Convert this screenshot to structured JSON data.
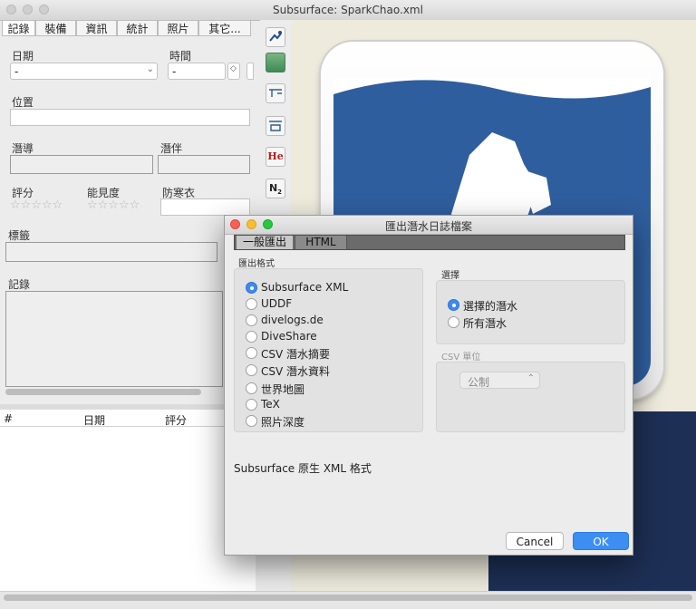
{
  "window": {
    "title": "Subsurface: SparkChao.xml"
  },
  "tabs": [
    "記錄",
    "裝備",
    "資訊",
    "統計",
    "照片",
    "其它..."
  ],
  "form": {
    "date_label": "日期",
    "date_value": "-",
    "time_label": "時間",
    "time_value": "-",
    "location_label": "位置",
    "divemaster_label": "潛導",
    "buddy_label": "潛伴",
    "rating_label": "評分",
    "visibility_label": "能見度",
    "suit_label": "防寒衣",
    "tags_label": "標籤",
    "notes_label": "記錄",
    "rating_stars": "☆☆☆☆☆",
    "visibility_stars": "☆☆☆☆☆"
  },
  "dive_list": {
    "columns": [
      "#",
      "日期",
      "評分"
    ]
  },
  "toolbar": {
    "icons": [
      "diver-icon",
      "calculator-icon",
      "ruler-icon",
      "ceiling-icon",
      "helium-icon",
      "nitrogen-icon"
    ],
    "he_label": "He",
    "n2_label": "N",
    "n2_sub": "2"
  },
  "dialog": {
    "title": "匯出潛水日誌檔案",
    "tabs": [
      "一般匯出",
      "HTML"
    ],
    "format_group_title": "匯出格式",
    "formats": [
      "Subsurface XML",
      "UDDF",
      "divelogs.de",
      "DiveShare",
      "CSV 潛水摘要",
      "CSV 潛水資料",
      "世界地圖",
      "TeX",
      "照片深度"
    ],
    "selected_format": "Subsurface XML",
    "selection_group_title": "選擇",
    "selection_options": [
      "選擇的潛水",
      "所有潛水"
    ],
    "selected_selection": "選擇的潛水",
    "csv_units_title": "CSV 單位",
    "csv_units_value": "公制",
    "description": "Subsurface 原生 XML 格式",
    "cancel_label": "Cancel",
    "ok_label": "OK"
  },
  "colors": {
    "accent": "#3d8bf0",
    "logo_blue": "#2f5e9e",
    "ok_button": "#3c8ef3"
  }
}
